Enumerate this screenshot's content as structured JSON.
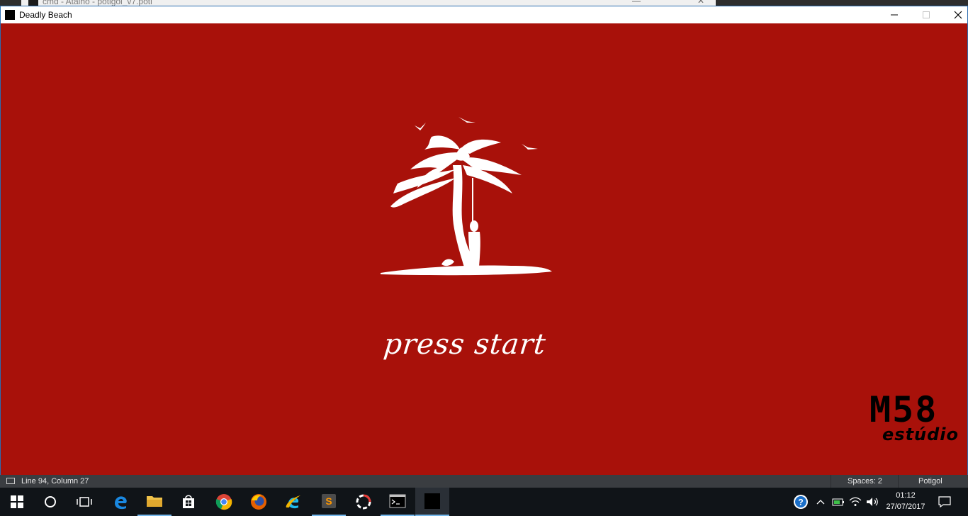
{
  "background_window": {
    "title": "cmd - Atalho - potigol_v7.poti"
  },
  "game_window": {
    "title": "Deadly Beach",
    "background_color": "#a8110a",
    "press_start_label": "press start",
    "studio_logo": {
      "big": "M58",
      "small": "estúdio"
    }
  },
  "status_bar": {
    "position": "Line 94, Column 27",
    "spaces": "Spaces: 2",
    "syntax": "Potigol"
  },
  "taskbar": {
    "apps": [
      {
        "name": "start-icon"
      },
      {
        "name": "cortana-icon"
      },
      {
        "name": "task-view-icon"
      },
      {
        "name": "edge-icon"
      },
      {
        "name": "file-explorer-icon"
      },
      {
        "name": "store-icon"
      },
      {
        "name": "chrome-icon"
      },
      {
        "name": "firefox-icon"
      },
      {
        "name": "internet-explorer-icon"
      },
      {
        "name": "sublime-text-icon"
      },
      {
        "name": "app-icon"
      },
      {
        "name": "cmd-icon"
      },
      {
        "name": "game-window-icon"
      }
    ],
    "time": "01:12",
    "date": "27/07/2017"
  }
}
